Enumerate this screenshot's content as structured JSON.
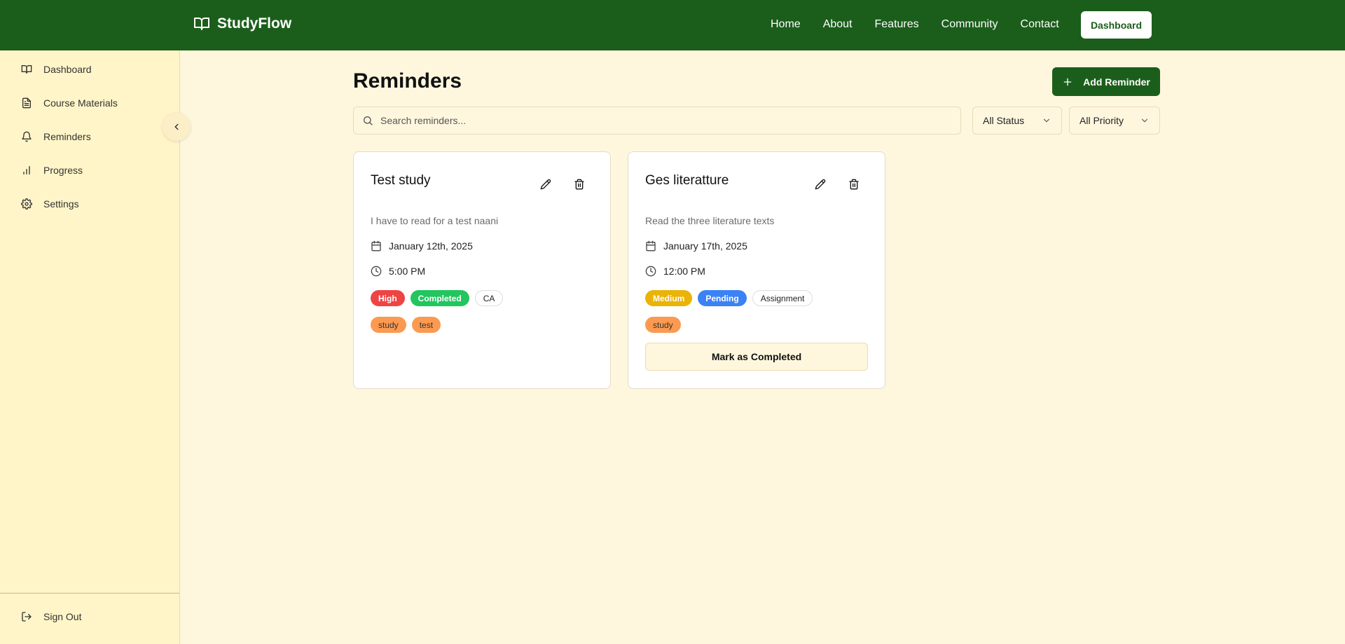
{
  "brand": {
    "name": "StudyFlow",
    "icon": "book-open-icon"
  },
  "nav": {
    "links": [
      "Home",
      "About",
      "Features",
      "Community",
      "Contact"
    ],
    "dashboard_button": "Dashboard"
  },
  "sidebar": {
    "items": [
      {
        "label": "Dashboard",
        "icon": "book-open-icon"
      },
      {
        "label": "Course Materials",
        "icon": "file-text-icon"
      },
      {
        "label": "Reminders",
        "icon": "bell-icon"
      },
      {
        "label": "Progress",
        "icon": "bar-chart-icon"
      },
      {
        "label": "Settings",
        "icon": "gear-icon"
      }
    ],
    "sign_out": "Sign Out"
  },
  "page": {
    "title": "Reminders",
    "add_button": "Add Reminder",
    "search_placeholder": "Search reminders...",
    "status_filter": "All Status",
    "priority_filter": "All Priority"
  },
  "colors": {
    "primary": "#1b5e1b",
    "background": "#fef7de",
    "sidebar": "#fff5c8",
    "high": "#ef4444",
    "medium": "#eab308",
    "completed": "#22c55e",
    "pending": "#3b82f6",
    "tag": "#fb9a50"
  },
  "reminders": [
    {
      "title": "Test study",
      "description": "I have to read for a test naani",
      "date": "January 12th, 2025",
      "time": "5:00 PM",
      "priority": "High",
      "status": "Completed",
      "category": "CA",
      "tags": [
        "study",
        "test"
      ]
    },
    {
      "title": "Ges literatture",
      "description": "Read the three literature texts",
      "date": "January 17th, 2025",
      "time": "12:00 PM",
      "priority": "Medium",
      "status": "Pending",
      "category": "Assignment",
      "tags": [
        "study"
      ],
      "action": "Mark as Completed"
    }
  ]
}
